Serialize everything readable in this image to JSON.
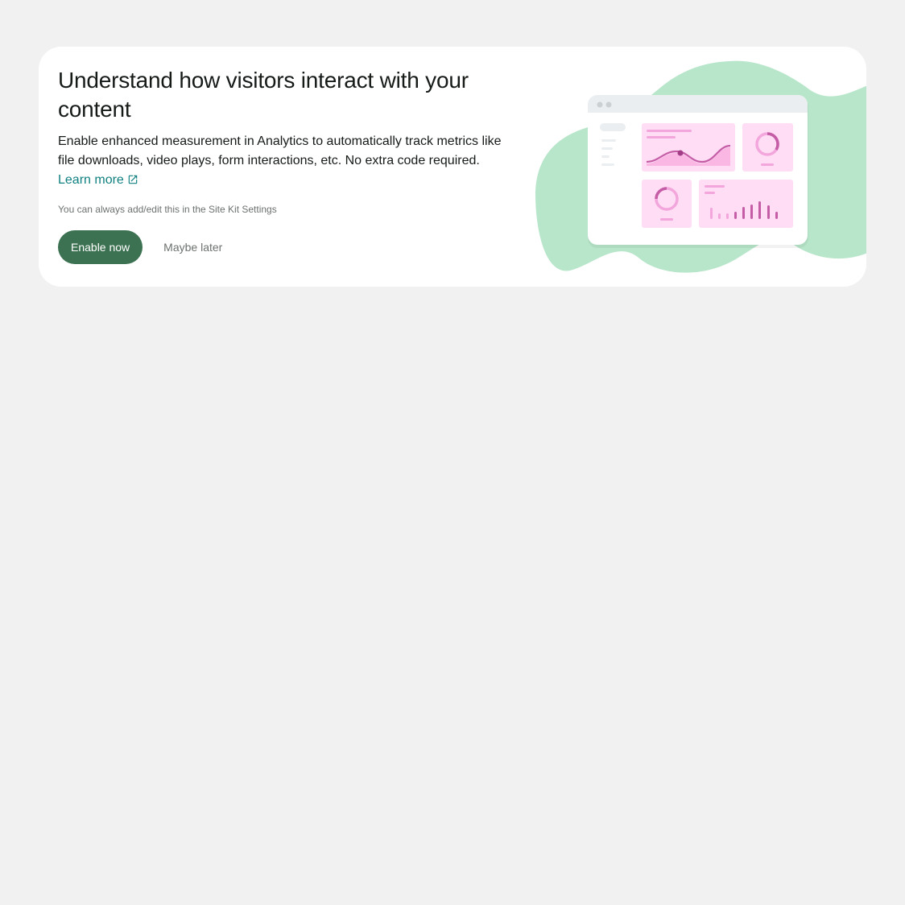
{
  "banner": {
    "title": "Understand how visitors interact with your content",
    "description": "Enable enhanced measurement in Analytics to automatically track metrics like file downloads, video plays, form interactions, etc. No extra code required.",
    "learn_more_label": "Learn more",
    "help_text": "You can always add/edit this in the Site Kit Settings",
    "enable_button_label": "Enable now",
    "dismiss_button_label": "Maybe later"
  },
  "icons": {
    "learn_more": "external-link-icon"
  },
  "colors": {
    "page_background": "#f1f1f1",
    "card_background": "#ffffff",
    "primary_button": "#3c7251",
    "link": "#108080",
    "blob": "#b8e6ca",
    "widget_fill": "#ffdef5",
    "chart_accent": "#c45da6"
  }
}
